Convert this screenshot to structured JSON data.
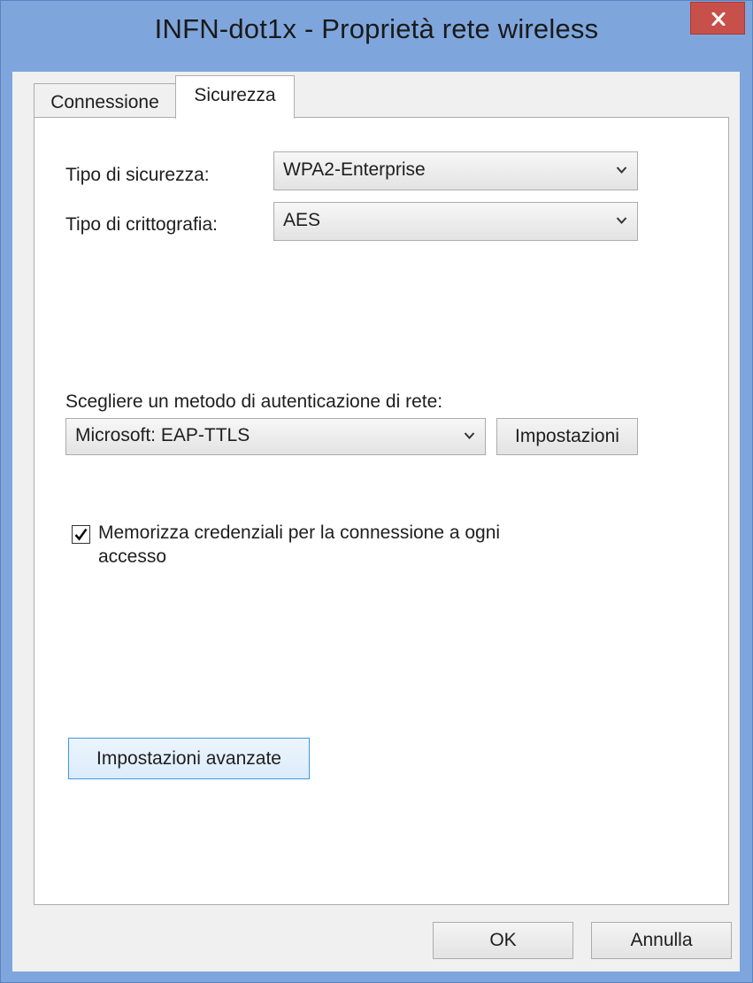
{
  "window": {
    "title": "INFN-dot1x - Proprietà rete wireless"
  },
  "tabs": [
    {
      "label": "Connessione",
      "active": false
    },
    {
      "label": "Sicurezza",
      "active": true
    }
  ],
  "security": {
    "type_label": "Tipo di sicurezza:",
    "type_value": "WPA2-Enterprise",
    "encryption_label": "Tipo di crittografia:",
    "encryption_value": "AES"
  },
  "auth": {
    "label": "Scegliere un metodo di autenticazione di rete:",
    "method_value": "Microsoft: EAP-TTLS",
    "settings_button": "Impostazioni",
    "remember_checked": true,
    "remember_line1": "Memorizza credenziali per la connessione a ogni",
    "remember_line2": "accesso"
  },
  "advanced_button": "Impostazioni avanzate",
  "footer": {
    "ok": "OK",
    "cancel": "Annulla"
  },
  "icons": {
    "close": "close-icon",
    "dropdown": "chevron-down-icon",
    "check": "checkmark-icon"
  },
  "colors": {
    "frame": "#7ea6dc",
    "close_button": "#c7504b",
    "default_button_border": "#3c9ae0"
  }
}
